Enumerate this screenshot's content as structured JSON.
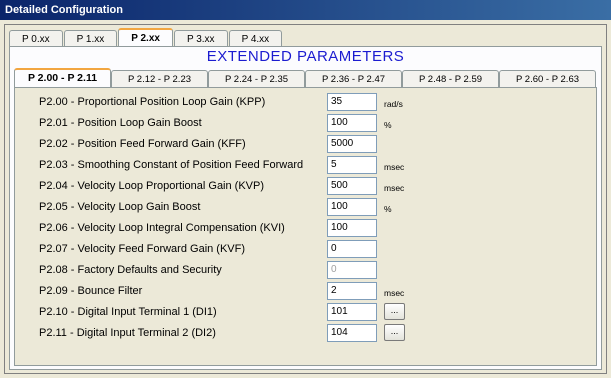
{
  "window": {
    "title": "Detailed Configuration"
  },
  "top_tabs": [
    "P 0.xx",
    "P 1.xx",
    "P 2.xx",
    "P 3.xx",
    "P 4.xx"
  ],
  "heading": "EXTENDED PARAMETERS",
  "sub_tabs": [
    "P 2.00 - P 2.11",
    "P 2.12 - P 2.23",
    "P 2.24 - P 2.35",
    "P 2.36 - P 2.47",
    "P 2.48 - P 2.59",
    "P 2.60 - P 2.63"
  ],
  "params": [
    {
      "label": "P2.00 - Proportional Position Loop Gain (KPP)",
      "value": "35",
      "unit": "rad/s"
    },
    {
      "label": "P2.01 - Position Loop Gain Boost",
      "value": "100",
      "unit": "%"
    },
    {
      "label": "P2.02 - Position Feed Forward Gain (KFF)",
      "value": "5000",
      "unit": ""
    },
    {
      "label": "P2.03 - Smoothing Constant of Position Feed Forward",
      "value": "5",
      "unit": "msec"
    },
    {
      "label": "P2.04 - Velocity Loop Proportional Gain (KVP)",
      "value": "500",
      "unit": "msec"
    },
    {
      "label": "P2.05 - Velocity Loop Gain Boost",
      "value": "100",
      "unit": "%"
    },
    {
      "label": "P2.06 - Velocity Loop Integral Compensation (KVI)",
      "value": "100",
      "unit": ""
    },
    {
      "label": "P2.07 - Velocity Feed Forward Gain (KVF)",
      "value": "0",
      "unit": ""
    },
    {
      "label": "P2.08 - Factory Defaults and Security",
      "value": "0",
      "unit": ""
    },
    {
      "label": "P2.09 - Bounce Filter",
      "value": "2",
      "unit": "msec"
    },
    {
      "label": "P2.10 - Digital Input Terminal 1 (DI1)",
      "value": "101",
      "unit": ""
    },
    {
      "label": "P2.11 - Digital Input Terminal 2 (DI2)",
      "value": "104",
      "unit": ""
    }
  ],
  "browse_label": "..."
}
